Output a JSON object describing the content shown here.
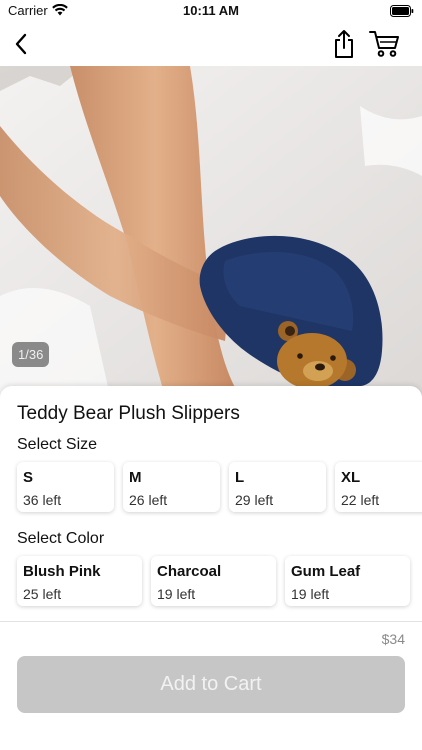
{
  "status": {
    "carrier": "Carrier",
    "time": "10:11 AM"
  },
  "hero": {
    "counter": "1/36"
  },
  "product": {
    "title": "Teddy Bear Plush Slippers"
  },
  "size": {
    "label": "Select Size",
    "options": [
      {
        "name": "S",
        "stock": "36 left"
      },
      {
        "name": "M",
        "stock": "26 left"
      },
      {
        "name": "L",
        "stock": "29 left"
      },
      {
        "name": "XL",
        "stock": "22 left"
      }
    ]
  },
  "color": {
    "label": "Select Color",
    "options": [
      {
        "name": "Blush Pink",
        "stock": "25 left"
      },
      {
        "name": "Charcoal",
        "stock": "19 left"
      },
      {
        "name": "Gum Leaf",
        "stock": "19 left"
      }
    ]
  },
  "footer": {
    "price": "$34",
    "add_to_cart": "Add to Cart"
  },
  "icons": {
    "back": "chevron-left-icon",
    "share": "share-icon",
    "cart": "cart-icon",
    "wifi": "wifi-icon",
    "battery": "battery-icon"
  },
  "colors": {
    "button_disabled": "#c6c6c6",
    "slipper": "#1e3566",
    "bear": "#b5782c"
  }
}
